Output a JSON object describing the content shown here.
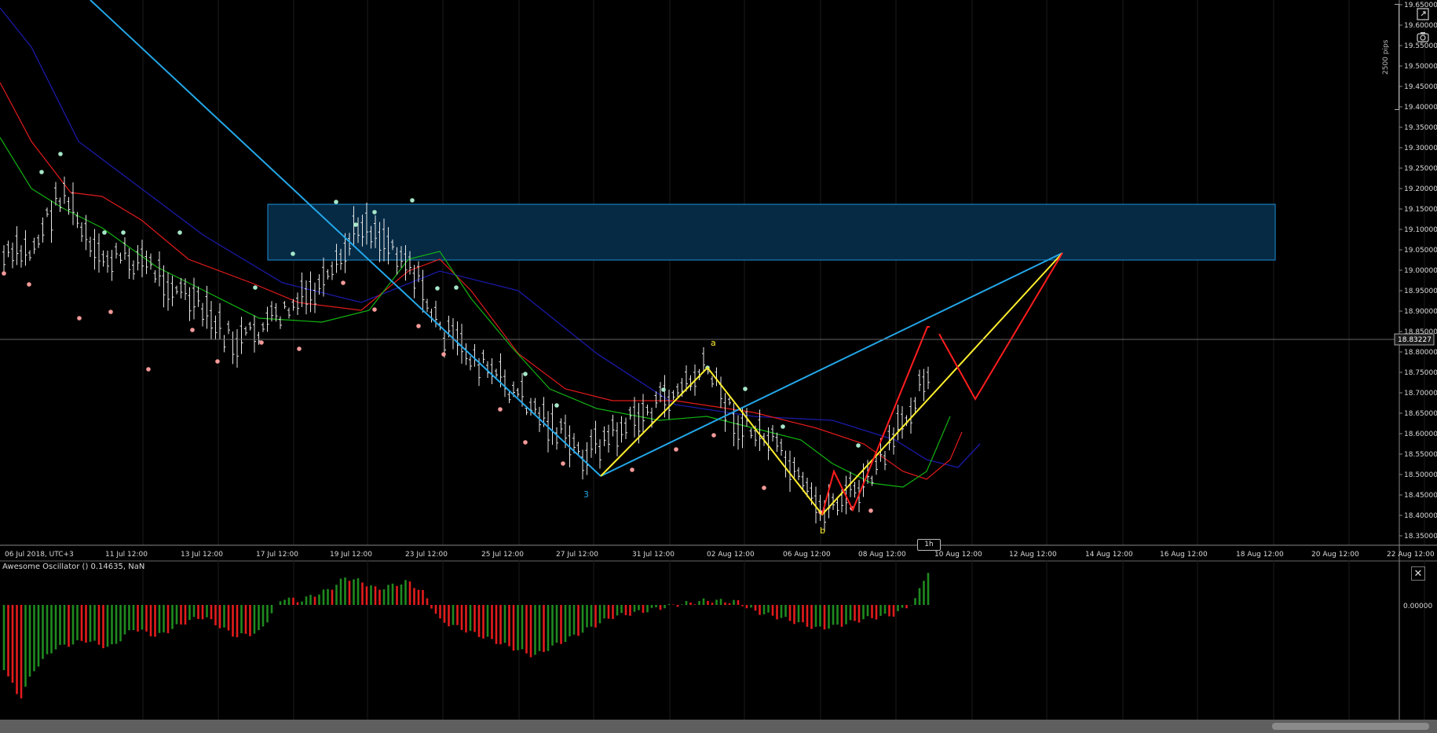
{
  "current_price": "18.83227",
  "pips_label": "2500 pips",
  "timeframe_badge": "1h",
  "price_axis": {
    "labels": [
      "19.65000",
      "19.60000",
      "19.55000",
      "19.50000",
      "19.45000",
      "19.40000",
      "19.35000",
      "19.30000",
      "19.25000",
      "19.20000",
      "19.15000",
      "19.10000",
      "19.05000",
      "19.00000",
      "18.95000",
      "18.90000",
      "18.85000",
      "18.80000",
      "18.75000",
      "18.70000",
      "18.65000",
      "18.60000",
      "18.55000",
      "18.50000",
      "18.45000",
      "18.40000",
      "18.35000"
    ]
  },
  "time_axis": {
    "labels": [
      "06 Jul 2018, UTC+3",
      "11 Jul 12:00",
      "13 Jul 12:00",
      "17 Jul 12:00",
      "19 Jul 12:00",
      "23 Jul 12:00",
      "25 Jul 12:00",
      "27 Jul 12:00",
      "31 Jul 12:00",
      "02 Aug 12:00",
      "06 Aug 12:00",
      "08 Aug 12:00",
      "10 Aug 12:00",
      "12 Aug 12:00",
      "14 Aug 12:00",
      "16 Aug 12:00",
      "18 Aug 12:00",
      "20 Aug 12:00",
      "22 Aug 12:00"
    ]
  },
  "wave_labels": {
    "three": "3",
    "a": "a",
    "b": "b"
  },
  "oscillator": {
    "label": "Awesome Oscillator () 0.14635, NaN",
    "zero_label": "0.00000",
    "up_color": "#1f8a1f",
    "down_color": "#e31b1b"
  },
  "colors": {
    "zone_fill": "#062a44",
    "zone_border": "#1f8fd6",
    "trendline": "#23a7e8",
    "pattern_yellow": "#ffee2e",
    "pattern_red": "#ff1d1d",
    "ma_green": "#12b312",
    "ma_red": "#e31b1b",
    "ma_blue": "#1a1aa8",
    "bullish_dot": "#a6e6c8",
    "bearish_dot": "#f59a9a"
  },
  "icons": {
    "expand": "expand-icon",
    "camera": "camera-icon",
    "close": "close-icon"
  }
}
